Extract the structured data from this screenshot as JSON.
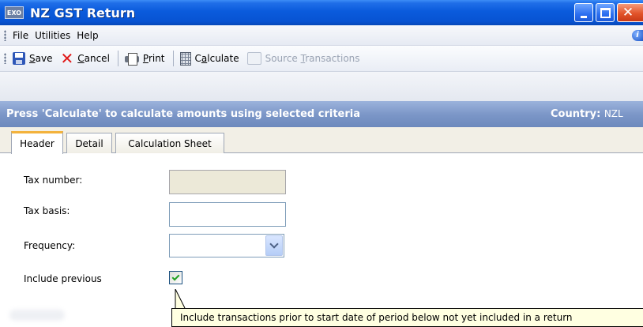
{
  "window": {
    "app_icon_text": "EXO",
    "title": "NZ GST Return",
    "controls": {
      "minimize": "minimize",
      "maximize": "maximize",
      "close": "close"
    }
  },
  "menu": {
    "items": [
      {
        "label": "File"
      },
      {
        "label": "Utilities"
      },
      {
        "label": "Help"
      }
    ]
  },
  "toolbar": {
    "save": {
      "label": "Save",
      "icon": "save-icon"
    },
    "cancel": {
      "label": "Cancel",
      "icon": "cancel-icon",
      "glyph": "✕"
    },
    "print": {
      "label": "Print",
      "icon": "printer-icon"
    },
    "calculate": {
      "label": "Calculate",
      "icon": "calculator-icon"
    },
    "source_transactions": {
      "label": "Source Transactions",
      "icon": "source-transactions-icon",
      "disabled": true
    }
  },
  "banner": {
    "message": "Press 'Calculate' to calculate amounts using selected criteria",
    "country_label": "Country:",
    "country_value": "NZL"
  },
  "tabs": [
    {
      "label": "Header",
      "active": true
    },
    {
      "label": "Detail",
      "active": false
    },
    {
      "label": "Calculation Sheet",
      "active": false
    }
  ],
  "form": {
    "tax_number": {
      "label": "Tax number:",
      "value": "",
      "disabled": true
    },
    "tax_basis": {
      "label": "Tax basis:",
      "value": ""
    },
    "frequency": {
      "label": "Frequency:",
      "value": ""
    },
    "include_previous": {
      "label": "Include previous",
      "checked": true
    }
  },
  "tooltip": {
    "text": "Include transactions prior to start date of period below not yet included in a return"
  },
  "colors": {
    "titlebar": "#0a5bdc",
    "banner": "#7c97c8",
    "active_tab_accent": "#f3b23c",
    "tooltip_bg": "#ffffe1"
  }
}
